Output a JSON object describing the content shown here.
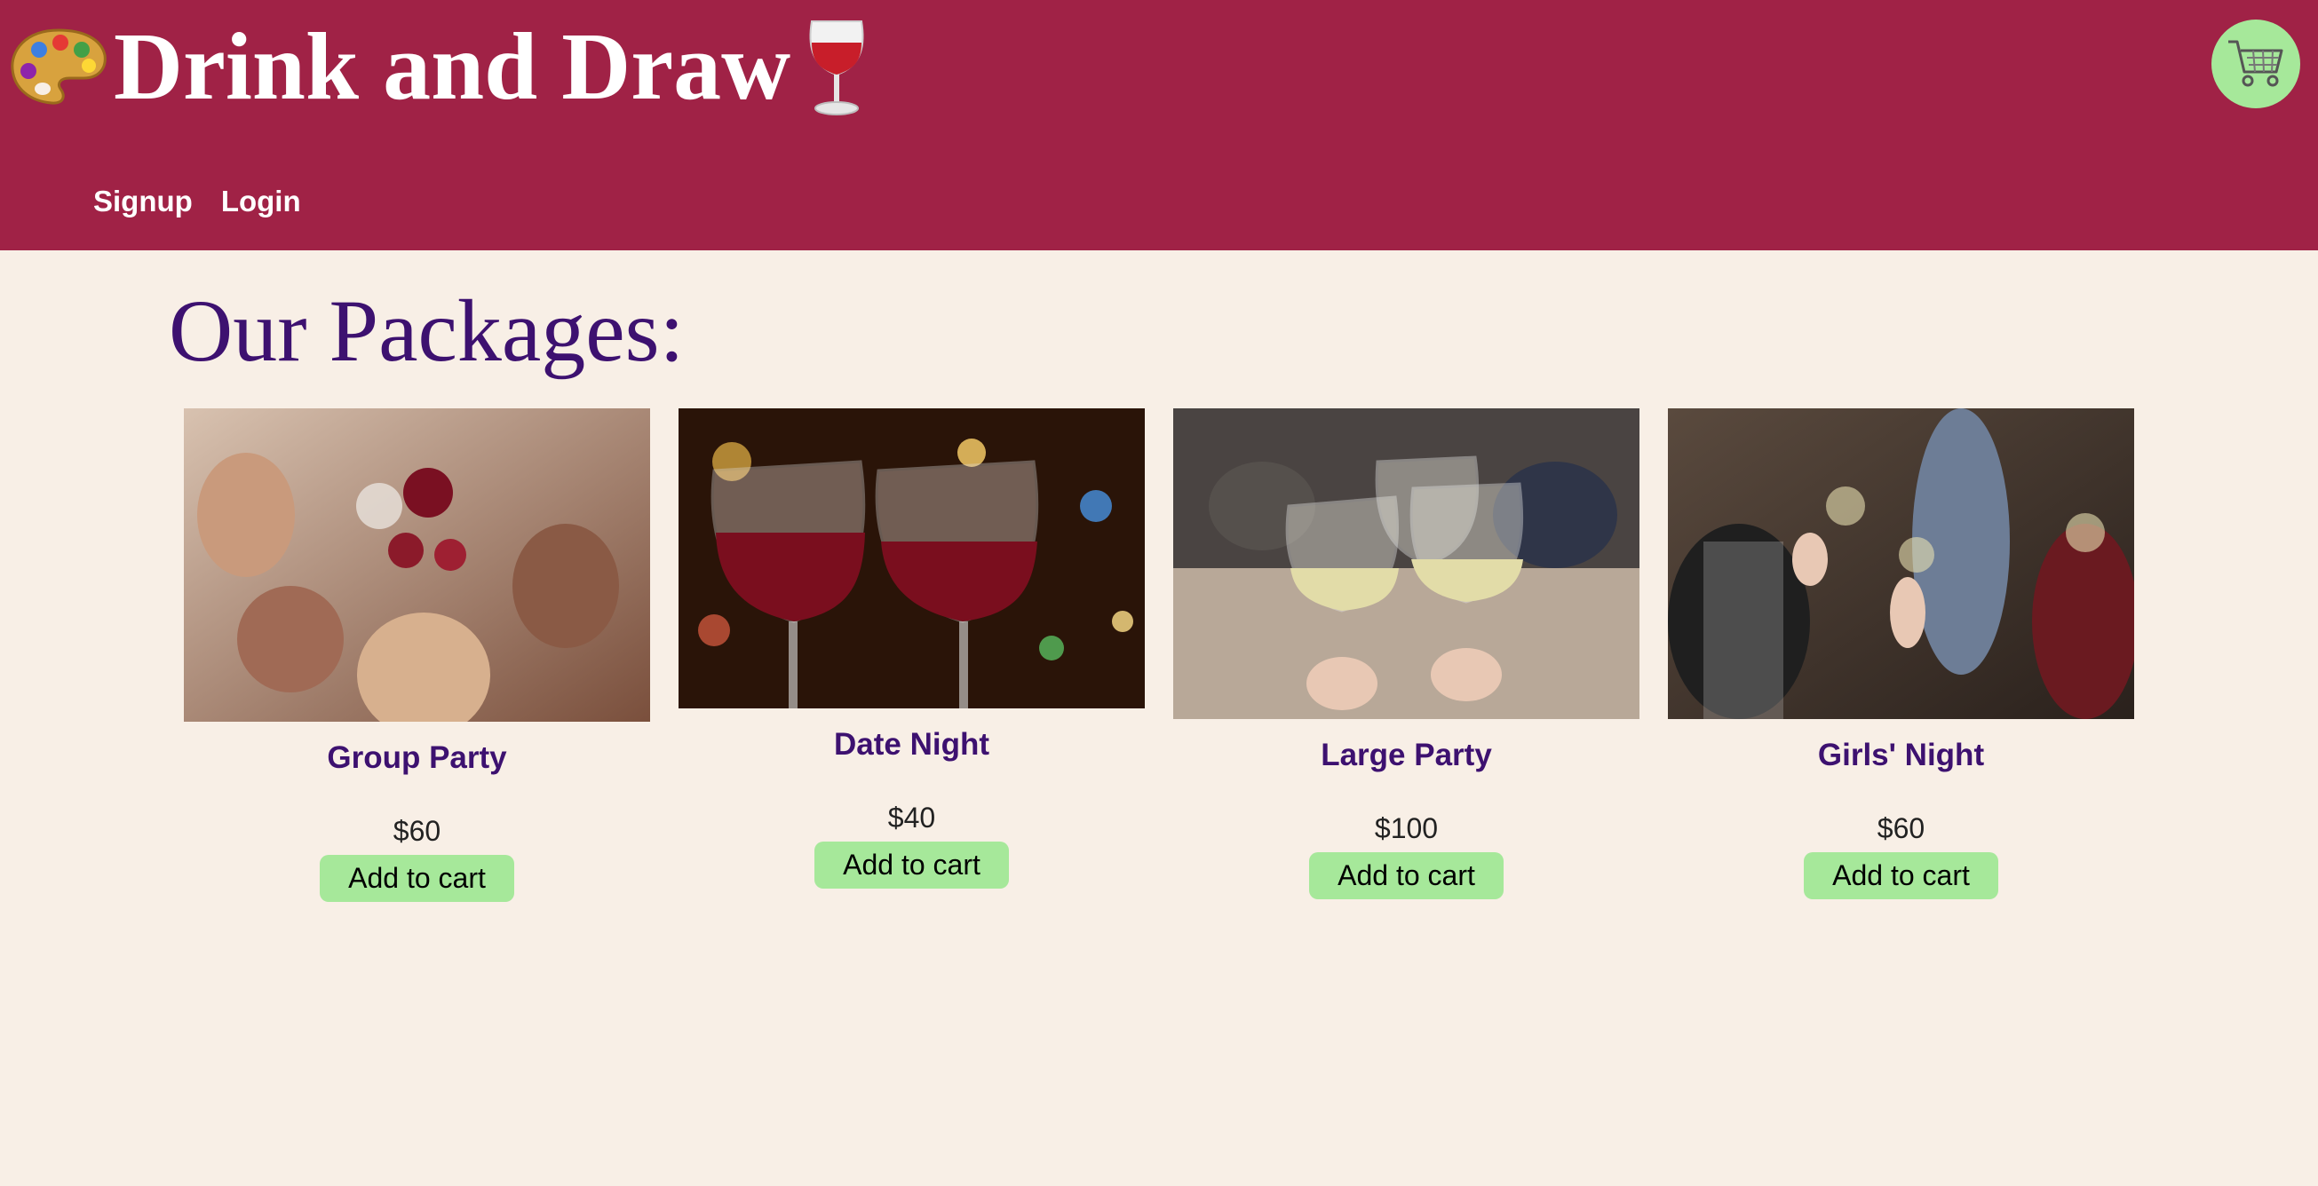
{
  "header": {
    "title": "Drink and Draw",
    "left_icon": "palette-icon",
    "right_icon": "wine-glass-icon",
    "cart_icon": "shopping-cart-icon",
    "colors": {
      "header_bg": "#a02246",
      "cart_bg": "#a6e89a"
    }
  },
  "nav": {
    "items": [
      {
        "label": "Signup"
      },
      {
        "label": "Login"
      }
    ]
  },
  "main": {
    "title": "Our Packages:",
    "colors": {
      "page_bg": "#f8efe6",
      "title": "#3d1170",
      "button_bg": "#a6e89a"
    },
    "packages": [
      {
        "name": "Group Party",
        "price": "$60",
        "button_label": "Add to cart"
      },
      {
        "name": "Date Night",
        "price": "$40",
        "button_label": "Add to cart"
      },
      {
        "name": "Large Party",
        "price": "$100",
        "button_label": "Add to cart"
      },
      {
        "name": "Girls' Night",
        "price": "$60",
        "button_label": "Add to cart"
      }
    ]
  }
}
